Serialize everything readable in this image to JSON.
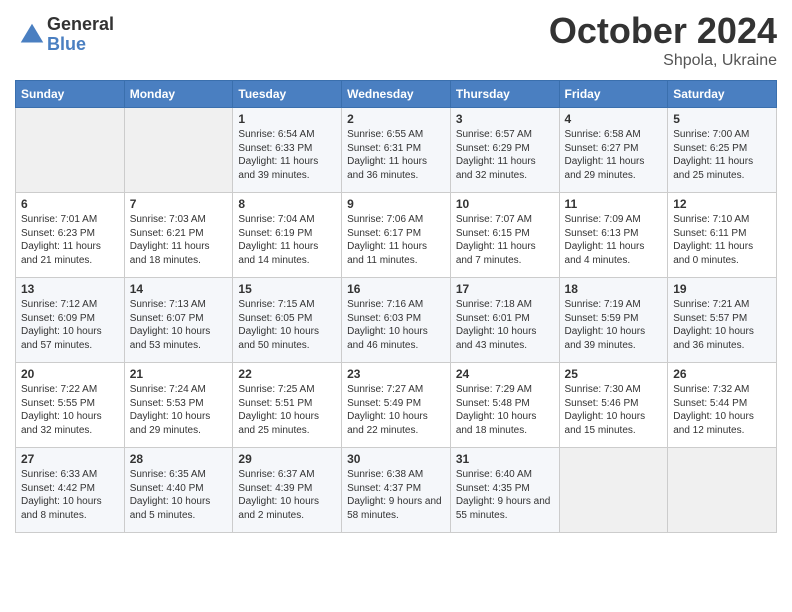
{
  "logo": {
    "general": "General",
    "blue": "Blue"
  },
  "title": "October 2024",
  "subtitle": "Shpola, Ukraine",
  "days_header": [
    "Sunday",
    "Monday",
    "Tuesday",
    "Wednesday",
    "Thursday",
    "Friday",
    "Saturday"
  ],
  "weeks": [
    [
      {
        "day": "",
        "info": ""
      },
      {
        "day": "",
        "info": ""
      },
      {
        "day": "1",
        "info": "Sunrise: 6:54 AM\nSunset: 6:33 PM\nDaylight: 11 hours and 39 minutes."
      },
      {
        "day": "2",
        "info": "Sunrise: 6:55 AM\nSunset: 6:31 PM\nDaylight: 11 hours and 36 minutes."
      },
      {
        "day": "3",
        "info": "Sunrise: 6:57 AM\nSunset: 6:29 PM\nDaylight: 11 hours and 32 minutes."
      },
      {
        "day": "4",
        "info": "Sunrise: 6:58 AM\nSunset: 6:27 PM\nDaylight: 11 hours and 29 minutes."
      },
      {
        "day": "5",
        "info": "Sunrise: 7:00 AM\nSunset: 6:25 PM\nDaylight: 11 hours and 25 minutes."
      }
    ],
    [
      {
        "day": "6",
        "info": "Sunrise: 7:01 AM\nSunset: 6:23 PM\nDaylight: 11 hours and 21 minutes."
      },
      {
        "day": "7",
        "info": "Sunrise: 7:03 AM\nSunset: 6:21 PM\nDaylight: 11 hours and 18 minutes."
      },
      {
        "day": "8",
        "info": "Sunrise: 7:04 AM\nSunset: 6:19 PM\nDaylight: 11 hours and 14 minutes."
      },
      {
        "day": "9",
        "info": "Sunrise: 7:06 AM\nSunset: 6:17 PM\nDaylight: 11 hours and 11 minutes."
      },
      {
        "day": "10",
        "info": "Sunrise: 7:07 AM\nSunset: 6:15 PM\nDaylight: 11 hours and 7 minutes."
      },
      {
        "day": "11",
        "info": "Sunrise: 7:09 AM\nSunset: 6:13 PM\nDaylight: 11 hours and 4 minutes."
      },
      {
        "day": "12",
        "info": "Sunrise: 7:10 AM\nSunset: 6:11 PM\nDaylight: 11 hours and 0 minutes."
      }
    ],
    [
      {
        "day": "13",
        "info": "Sunrise: 7:12 AM\nSunset: 6:09 PM\nDaylight: 10 hours and 57 minutes."
      },
      {
        "day": "14",
        "info": "Sunrise: 7:13 AM\nSunset: 6:07 PM\nDaylight: 10 hours and 53 minutes."
      },
      {
        "day": "15",
        "info": "Sunrise: 7:15 AM\nSunset: 6:05 PM\nDaylight: 10 hours and 50 minutes."
      },
      {
        "day": "16",
        "info": "Sunrise: 7:16 AM\nSunset: 6:03 PM\nDaylight: 10 hours and 46 minutes."
      },
      {
        "day": "17",
        "info": "Sunrise: 7:18 AM\nSunset: 6:01 PM\nDaylight: 10 hours and 43 minutes."
      },
      {
        "day": "18",
        "info": "Sunrise: 7:19 AM\nSunset: 5:59 PM\nDaylight: 10 hours and 39 minutes."
      },
      {
        "day": "19",
        "info": "Sunrise: 7:21 AM\nSunset: 5:57 PM\nDaylight: 10 hours and 36 minutes."
      }
    ],
    [
      {
        "day": "20",
        "info": "Sunrise: 7:22 AM\nSunset: 5:55 PM\nDaylight: 10 hours and 32 minutes."
      },
      {
        "day": "21",
        "info": "Sunrise: 7:24 AM\nSunset: 5:53 PM\nDaylight: 10 hours and 29 minutes."
      },
      {
        "day": "22",
        "info": "Sunrise: 7:25 AM\nSunset: 5:51 PM\nDaylight: 10 hours and 25 minutes."
      },
      {
        "day": "23",
        "info": "Sunrise: 7:27 AM\nSunset: 5:49 PM\nDaylight: 10 hours and 22 minutes."
      },
      {
        "day": "24",
        "info": "Sunrise: 7:29 AM\nSunset: 5:48 PM\nDaylight: 10 hours and 18 minutes."
      },
      {
        "day": "25",
        "info": "Sunrise: 7:30 AM\nSunset: 5:46 PM\nDaylight: 10 hours and 15 minutes."
      },
      {
        "day": "26",
        "info": "Sunrise: 7:32 AM\nSunset: 5:44 PM\nDaylight: 10 hours and 12 minutes."
      }
    ],
    [
      {
        "day": "27",
        "info": "Sunrise: 6:33 AM\nSunset: 4:42 PM\nDaylight: 10 hours and 8 minutes."
      },
      {
        "day": "28",
        "info": "Sunrise: 6:35 AM\nSunset: 4:40 PM\nDaylight: 10 hours and 5 minutes."
      },
      {
        "day": "29",
        "info": "Sunrise: 6:37 AM\nSunset: 4:39 PM\nDaylight: 10 hours and 2 minutes."
      },
      {
        "day": "30",
        "info": "Sunrise: 6:38 AM\nSunset: 4:37 PM\nDaylight: 9 hours and 58 minutes."
      },
      {
        "day": "31",
        "info": "Sunrise: 6:40 AM\nSunset: 4:35 PM\nDaylight: 9 hours and 55 minutes."
      },
      {
        "day": "",
        "info": ""
      },
      {
        "day": "",
        "info": ""
      }
    ]
  ]
}
